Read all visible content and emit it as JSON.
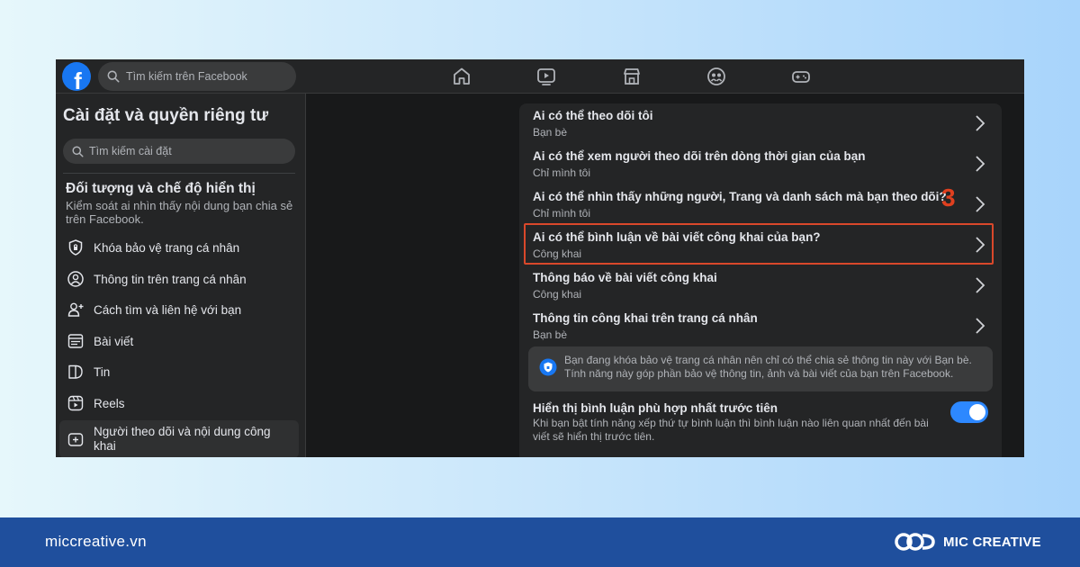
{
  "topbar": {
    "logo_letter": "f",
    "search_placeholder": "Tìm kiếm trên Facebook",
    "nav_icons": [
      "home-icon",
      "video-icon",
      "marketplace-icon",
      "groups-icon",
      "gaming-icon"
    ]
  },
  "sidebar": {
    "title": "Cài đặt và quyền riêng tư",
    "search_placeholder": "Tìm kiếm cài đặt",
    "section_title": "Đối tượng và chế độ hiển thị",
    "section_desc": "Kiểm soát ai nhìn thấy nội dung bạn chia sẻ trên Facebook.",
    "items": [
      {
        "label": "Khóa bảo vệ trang cá nhân",
        "icon": "shield-icon"
      },
      {
        "label": "Thông tin trên trang cá nhân",
        "icon": "profile-info-icon"
      },
      {
        "label": "Cách tìm và liên hệ với bạn",
        "icon": "person-add-icon"
      },
      {
        "label": "Bài viết",
        "icon": "post-icon"
      },
      {
        "label": "Tin",
        "icon": "story-icon"
      },
      {
        "label": "Reels",
        "icon": "reels-icon"
      },
      {
        "label": "Người theo dõi và nội dung công khai",
        "icon": "followers-icon",
        "active": true
      }
    ]
  },
  "settings": [
    {
      "title": "Ai có thể theo dõi tôi",
      "value": "Bạn bè"
    },
    {
      "title": "Ai có thể xem người theo dõi trên dòng thời gian của bạn",
      "value": "Chỉ mình tôi"
    },
    {
      "title": "Ai có thể nhìn thấy những người, Trang và danh sách mà bạn theo dõi?",
      "value": "Chỉ mình tôi"
    },
    {
      "title": "Ai có thể bình luận về bài viết công khai của bạn?",
      "value": "Công khai"
    },
    {
      "title": "Thông báo về bài viết công khai",
      "value": "Công khai"
    },
    {
      "title": "Thông tin công khai trên trang cá nhân",
      "value": "Bạn bè"
    }
  ],
  "step_marker": "3",
  "notice": {
    "text": "Bạn đang khóa bảo vệ trang cá nhân nên chỉ có thể chia sẻ thông tin này với Bạn bè. Tính năng này góp phần bảo vệ thông tin, ảnh và bài viết của bạn trên Facebook."
  },
  "toggle_setting": {
    "title": "Hiển thị bình luận phù hợp nhất trước tiên",
    "desc": "Khi bạn bật tính năng xếp thứ tự bình luận thì bình luận nào liên quan nhất đến bài viết sẽ hiển thị trước tiên.",
    "enabled": true
  },
  "footer": {
    "site": "miccreative.vn",
    "brand": "MIC CREATIVE"
  },
  "colors": {
    "accent": "#1877f2",
    "highlight": "#d9482b",
    "footer_bg": "#1f4f9d"
  }
}
